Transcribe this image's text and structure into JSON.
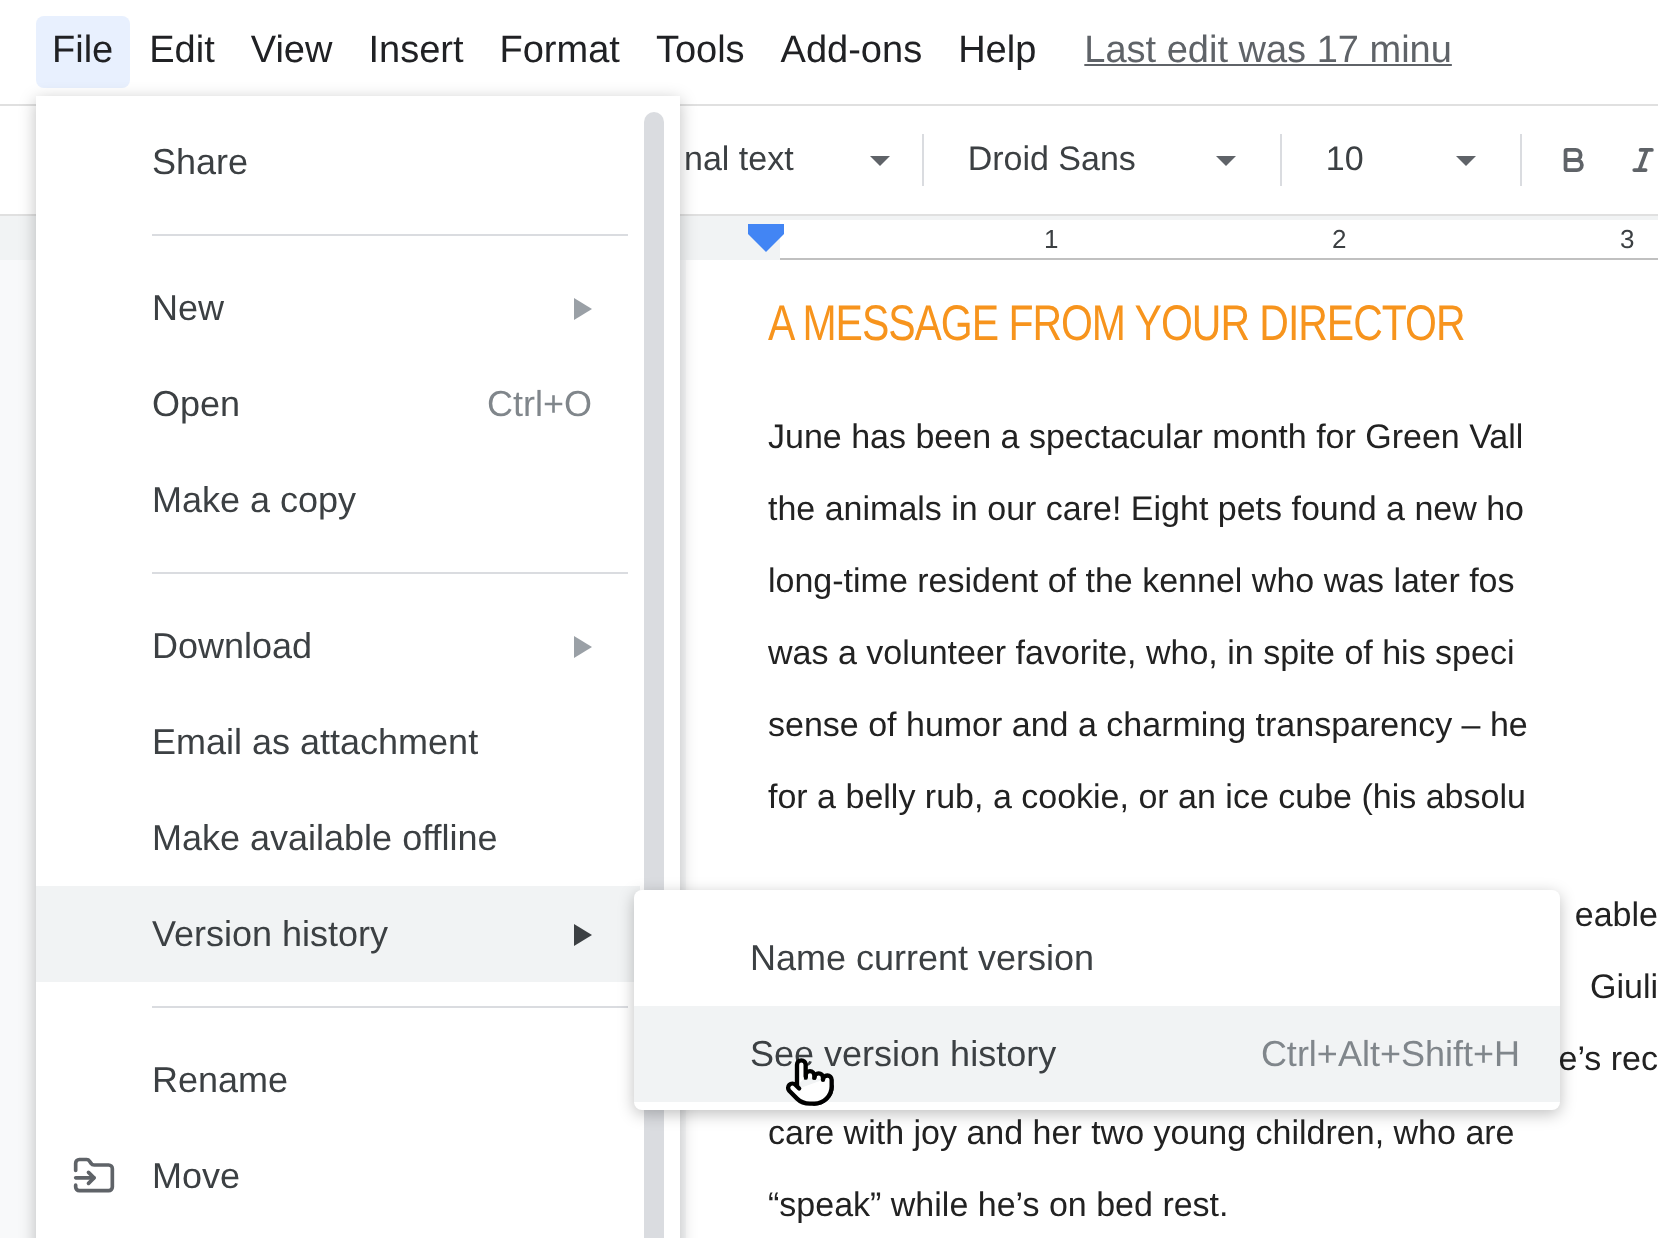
{
  "menubar": {
    "items": [
      {
        "label": "File",
        "selected": true
      },
      {
        "label": "Edit",
        "selected": false
      },
      {
        "label": "View",
        "selected": false
      },
      {
        "label": "Insert",
        "selected": false
      },
      {
        "label": "Format",
        "selected": false
      },
      {
        "label": "Tools",
        "selected": false
      },
      {
        "label": "Add-ons",
        "selected": false
      },
      {
        "label": "Help",
        "selected": false
      }
    ],
    "last_edit": "Last edit was 17 minu"
  },
  "toolbar": {
    "style": "nal text",
    "font": "Droid Sans",
    "size": "10"
  },
  "ruler": {
    "labels": [
      "1",
      "2",
      "3"
    ]
  },
  "document": {
    "heading": "A MESSAGE FROM YOUR DIRECTOR",
    "paragraphs": [
      [
        {
          "kind": "full",
          "text": "June has been a spectacular month for Green Vall"
        },
        {
          "kind": "full",
          "text": "the animals in our care! Eight pets found a new ho"
        },
        {
          "kind": "full",
          "text": "long-time resident of the kennel who was later fos"
        },
        {
          "kind": "full",
          "text": "was a volunteer favorite, who, in spite of his speci"
        },
        {
          "kind": "full",
          "text": "sense of humor and a charming transparency – he"
        },
        {
          "kind": "full",
          "text": "for a belly rub, a cookie, or an ice cube (his absolu"
        }
      ],
      [
        {
          "kind": "tail",
          "text": "eable"
        },
        {
          "kind": "tail",
          "text": "Giuli"
        },
        {
          "kind": "tail",
          "text": "e’s rec"
        },
        {
          "kind": "full",
          "text": "care with joy and her two young children, who are"
        },
        {
          "kind": "full",
          "text": "“speak” while he’s on bed rest."
        }
      ]
    ]
  },
  "file_menu": {
    "items": [
      {
        "kind": "item",
        "label": "Share",
        "selected": false
      },
      {
        "kind": "divider"
      },
      {
        "kind": "item",
        "label": "New",
        "submenu": true,
        "selected": false
      },
      {
        "kind": "item",
        "label": "Open",
        "shortcut": "Ctrl+O",
        "selected": false
      },
      {
        "kind": "item",
        "label": "Make a copy",
        "selected": false
      },
      {
        "kind": "divider"
      },
      {
        "kind": "item",
        "label": "Download",
        "submenu": true,
        "selected": false
      },
      {
        "kind": "item",
        "label": "Email as attachment",
        "selected": false
      },
      {
        "kind": "item",
        "label": "Make available offline",
        "selected": false
      },
      {
        "kind": "item",
        "label": "Version history",
        "submenu": true,
        "selected": true
      },
      {
        "kind": "divider"
      },
      {
        "kind": "item",
        "label": "Rename",
        "selected": false
      },
      {
        "kind": "folder_item",
        "label": "Move",
        "selected": false
      }
    ]
  },
  "submenu": {
    "items": [
      {
        "label": "Name current version",
        "selected": false
      },
      {
        "label": "See version history",
        "shortcut": "Ctrl+Alt+Shift+H",
        "selected": true
      }
    ]
  }
}
